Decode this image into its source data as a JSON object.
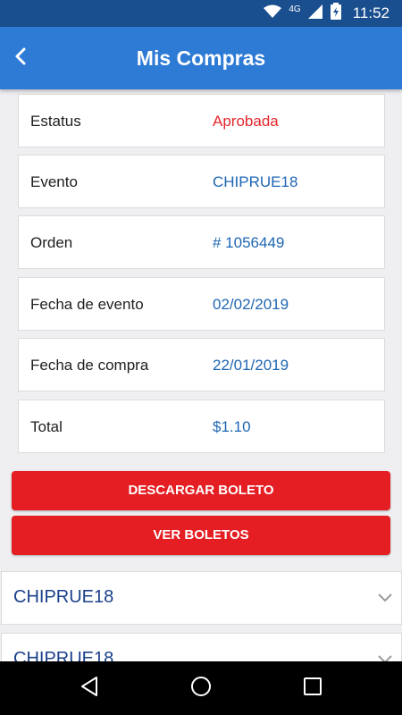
{
  "status_bar": {
    "time": "11:52",
    "network": "4G",
    "icons": [
      "wifi-icon",
      "cellular-signal-icon",
      "battery-charging-icon"
    ]
  },
  "app_bar": {
    "title": "Mis Compras",
    "back_icon": "chevron-left-icon"
  },
  "details": [
    {
      "label": "Estatus",
      "value": "Aprobada",
      "value_color": "#e3262b"
    },
    {
      "label": "Evento",
      "value": "CHIPRUE18",
      "value_color": "#1f66b3"
    },
    {
      "label": "Orden",
      "value": "# 1056449",
      "value_color": "#1f66b3"
    },
    {
      "label": "Fecha de evento",
      "value": "02/02/2019",
      "value_color": "#1f66b3"
    },
    {
      "label": "Fecha de compra",
      "value": "22/01/2019",
      "value_color": "#1f66b3"
    },
    {
      "label": "Total",
      "value": "$1.10",
      "value_color": "#1f66b3"
    }
  ],
  "actions": {
    "download_label": "DESCARGAR BOLETO",
    "view_label": "VER BOLETOS"
  },
  "purchases": [
    {
      "title": "CHIPRUE18",
      "icon": "chevron-down-icon"
    },
    {
      "title": "CHIPRUE18",
      "icon": "chevron-down-icon"
    }
  ],
  "nav_bar": {
    "icons": [
      "back-triangle-icon",
      "home-circle-icon",
      "recents-square-icon"
    ]
  },
  "colors": {
    "status_bar": "#1a4f8f",
    "app_bar": "#2e7bd6",
    "button": "#e41e23",
    "value_blue": "#1f66b3",
    "accordion_text": "#1a3f8a",
    "background": "#efeff2"
  }
}
